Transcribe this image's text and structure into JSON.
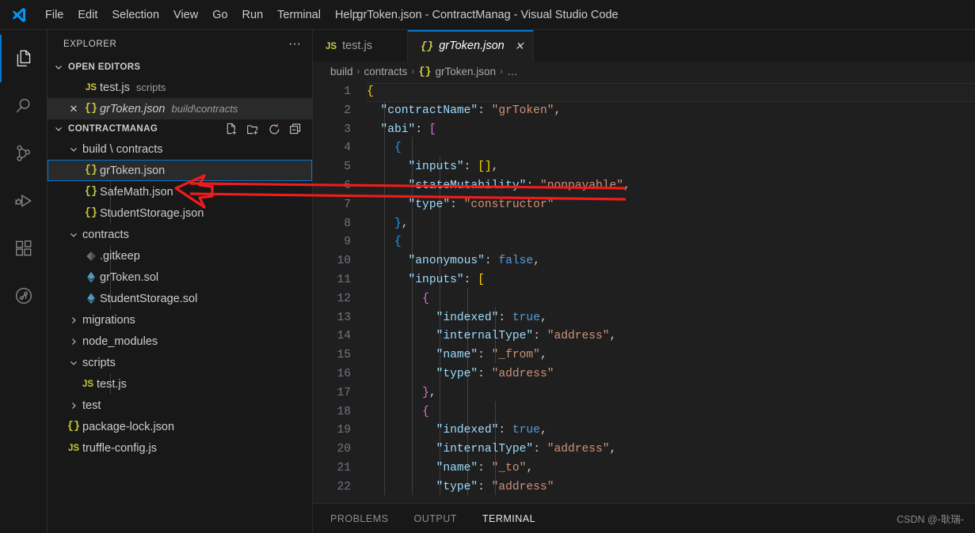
{
  "window": {
    "title": "grToken.json - ContractManag - Visual Studio Code",
    "logo_icon": "vscode-logo-icon"
  },
  "menubar": {
    "items": [
      {
        "label": "File"
      },
      {
        "label": "Edit"
      },
      {
        "label": "Selection"
      },
      {
        "label": "View"
      },
      {
        "label": "Go"
      },
      {
        "label": "Run"
      },
      {
        "label": "Terminal"
      },
      {
        "label": "Help"
      }
    ]
  },
  "activitybar": {
    "items": [
      {
        "icon": "explorer-files-icon",
        "name": "explorer",
        "active": true
      },
      {
        "icon": "search-icon",
        "name": "search",
        "active": false
      },
      {
        "icon": "source-control-icon",
        "name": "source-control",
        "active": false
      },
      {
        "icon": "run-debug-icon",
        "name": "run-and-debug",
        "active": false
      },
      {
        "icon": "extensions-icon",
        "name": "extensions",
        "active": false
      },
      {
        "icon": "testing-beaker-icon",
        "name": "testing",
        "active": false
      }
    ]
  },
  "sidebar": {
    "header_title": "EXPLORER",
    "header_more_icon": "ellipsis-icon",
    "open_editors": {
      "label": "OPEN EDITORS",
      "expanded": true,
      "chevron_icon": "chevron-down-icon",
      "items": [
        {
          "name": "test.js",
          "description": "scripts",
          "icon": "js-file-icon",
          "dirty": false,
          "active": false,
          "closable": false
        },
        {
          "name": "grToken.json",
          "description": "build\\contracts",
          "icon": "json-file-icon",
          "dirty": false,
          "active": true,
          "closable": true,
          "close_icon": "close-icon"
        }
      ]
    },
    "workspace": {
      "label": "CONTRACTMANAG",
      "chevron_icon": "chevron-down-icon",
      "actions": [
        {
          "icon": "new-file-icon",
          "name": "new-file"
        },
        {
          "icon": "new-folder-icon",
          "name": "new-folder"
        },
        {
          "icon": "refresh-icon",
          "name": "refresh-explorer"
        },
        {
          "icon": "collapse-all-icon",
          "name": "collapse-folders"
        }
      ],
      "tree": [
        {
          "label": "build \\ contracts",
          "type": "folder",
          "expanded": true,
          "depth": 1,
          "icon": "chevron-down-icon"
        },
        {
          "label": "grToken.json",
          "type": "file",
          "depth": 2,
          "icon": "json-file-icon",
          "selected": true
        },
        {
          "label": "SafeMath.json",
          "type": "file",
          "depth": 2,
          "icon": "json-file-icon",
          "selected": false
        },
        {
          "label": "StudentStorage.json",
          "type": "file",
          "depth": 2,
          "icon": "json-file-icon",
          "selected": false
        },
        {
          "label": "contracts",
          "type": "folder",
          "expanded": true,
          "depth": 1,
          "icon": "chevron-down-icon"
        },
        {
          "label": ".gitkeep",
          "type": "file",
          "depth": 2,
          "icon": "git-file-icon",
          "selected": false
        },
        {
          "label": "grToken.sol",
          "type": "file",
          "depth": 2,
          "icon": "solidity-file-icon",
          "selected": false
        },
        {
          "label": "StudentStorage.sol",
          "type": "file",
          "depth": 2,
          "icon": "solidity-file-icon",
          "selected": false
        },
        {
          "label": "migrations",
          "type": "folder",
          "expanded": false,
          "depth": 1,
          "icon": "chevron-right-icon"
        },
        {
          "label": "node_modules",
          "type": "folder",
          "expanded": false,
          "depth": 1,
          "icon": "chevron-right-icon"
        },
        {
          "label": "scripts",
          "type": "folder",
          "expanded": true,
          "depth": 1,
          "icon": "chevron-down-icon"
        },
        {
          "label": "test.js",
          "type": "file",
          "depth": 2,
          "icon": "js-file-icon",
          "selected": false
        },
        {
          "label": "test",
          "type": "folder",
          "expanded": false,
          "depth": 1,
          "icon": "chevron-right-icon"
        },
        {
          "label": "package-lock.json",
          "type": "file",
          "depth": 1,
          "icon": "json-file-icon",
          "selected": false
        },
        {
          "label": "truffle-config.js",
          "type": "file",
          "depth": 1,
          "icon": "js-file-icon",
          "selected": false
        }
      ]
    }
  },
  "editor": {
    "tabs": [
      {
        "label": "test.js",
        "icon": "js-file-icon",
        "active": false,
        "closable": false
      },
      {
        "label": "grToken.json",
        "icon": "json-file-icon",
        "active": true,
        "closable": true,
        "close_icon": "close-icon"
      }
    ],
    "breadcrumb": [
      {
        "label": "build",
        "icon": null
      },
      {
        "label": "contracts",
        "icon": null
      },
      {
        "label": "grToken.json",
        "icon": "json-file-icon"
      },
      {
        "label": "…",
        "icon": null
      }
    ],
    "breadcrumb_separator": "›",
    "first_line_number": 1,
    "lines": [
      {
        "n": 1,
        "indent": 0,
        "tokens": [
          {
            "t": "{",
            "c": "k-brace1"
          }
        ],
        "current": true
      },
      {
        "n": 2,
        "indent": 1,
        "tokens": [
          {
            "t": "\"contractName\"",
            "c": "k-key"
          },
          {
            "t": ": ",
            "c": "k-punc"
          },
          {
            "t": "\"grToken\"",
            "c": "k-str"
          },
          {
            "t": ",",
            "c": "k-punc"
          }
        ]
      },
      {
        "n": 3,
        "indent": 1,
        "tokens": [
          {
            "t": "\"abi\"",
            "c": "k-key"
          },
          {
            "t": ": ",
            "c": "k-punc"
          },
          {
            "t": "[",
            "c": "k-brace2"
          }
        ]
      },
      {
        "n": 4,
        "indent": 2,
        "tokens": [
          {
            "t": "{",
            "c": "k-brace3"
          }
        ]
      },
      {
        "n": 5,
        "indent": 3,
        "tokens": [
          {
            "t": "\"inputs\"",
            "c": "k-key"
          },
          {
            "t": ": ",
            "c": "k-punc"
          },
          {
            "t": "[]",
            "c": "k-brace1"
          },
          {
            "t": ",",
            "c": "k-punc"
          }
        ]
      },
      {
        "n": 6,
        "indent": 3,
        "tokens": [
          {
            "t": "\"stateMutability\"",
            "c": "k-key"
          },
          {
            "t": ": ",
            "c": "k-punc"
          },
          {
            "t": "\"nonpayable\"",
            "c": "k-str"
          },
          {
            "t": ",",
            "c": "k-punc"
          }
        ]
      },
      {
        "n": 7,
        "indent": 3,
        "tokens": [
          {
            "t": "\"type\"",
            "c": "k-key"
          },
          {
            "t": ": ",
            "c": "k-punc"
          },
          {
            "t": "\"constructor\"",
            "c": "k-str"
          }
        ]
      },
      {
        "n": 8,
        "indent": 2,
        "tokens": [
          {
            "t": "}",
            "c": "k-brace3"
          },
          {
            "t": ",",
            "c": "k-punc"
          }
        ]
      },
      {
        "n": 9,
        "indent": 2,
        "tokens": [
          {
            "t": "{",
            "c": "k-brace3"
          }
        ]
      },
      {
        "n": 10,
        "indent": 3,
        "tokens": [
          {
            "t": "\"anonymous\"",
            "c": "k-key"
          },
          {
            "t": ": ",
            "c": "k-punc"
          },
          {
            "t": "false",
            "c": "k-bool"
          },
          {
            "t": ",",
            "c": "k-punc"
          }
        ]
      },
      {
        "n": 11,
        "indent": 3,
        "tokens": [
          {
            "t": "\"inputs\"",
            "c": "k-key"
          },
          {
            "t": ": ",
            "c": "k-punc"
          },
          {
            "t": "[",
            "c": "k-brace1"
          }
        ]
      },
      {
        "n": 12,
        "indent": 4,
        "tokens": [
          {
            "t": "{",
            "c": "k-brace2"
          }
        ]
      },
      {
        "n": 13,
        "indent": 5,
        "tokens": [
          {
            "t": "\"indexed\"",
            "c": "k-key"
          },
          {
            "t": ": ",
            "c": "k-punc"
          },
          {
            "t": "true",
            "c": "k-bool"
          },
          {
            "t": ",",
            "c": "k-punc"
          }
        ]
      },
      {
        "n": 14,
        "indent": 5,
        "tokens": [
          {
            "t": "\"internalType\"",
            "c": "k-key"
          },
          {
            "t": ": ",
            "c": "k-punc"
          },
          {
            "t": "\"address\"",
            "c": "k-str"
          },
          {
            "t": ",",
            "c": "k-punc"
          }
        ]
      },
      {
        "n": 15,
        "indent": 5,
        "tokens": [
          {
            "t": "\"name\"",
            "c": "k-key"
          },
          {
            "t": ": ",
            "c": "k-punc"
          },
          {
            "t": "\"_from\"",
            "c": "k-str"
          },
          {
            "t": ",",
            "c": "k-punc"
          }
        ]
      },
      {
        "n": 16,
        "indent": 5,
        "tokens": [
          {
            "t": "\"type\"",
            "c": "k-key"
          },
          {
            "t": ": ",
            "c": "k-punc"
          },
          {
            "t": "\"address\"",
            "c": "k-str"
          }
        ]
      },
      {
        "n": 17,
        "indent": 4,
        "tokens": [
          {
            "t": "}",
            "c": "k-brace2"
          },
          {
            "t": ",",
            "c": "k-punc"
          }
        ]
      },
      {
        "n": 18,
        "indent": 4,
        "tokens": [
          {
            "t": "{",
            "c": "k-brace2"
          }
        ]
      },
      {
        "n": 19,
        "indent": 5,
        "tokens": [
          {
            "t": "\"indexed\"",
            "c": "k-key"
          },
          {
            "t": ": ",
            "c": "k-punc"
          },
          {
            "t": "true",
            "c": "k-bool"
          },
          {
            "t": ",",
            "c": "k-punc"
          }
        ]
      },
      {
        "n": 20,
        "indent": 5,
        "tokens": [
          {
            "t": "\"internalType\"",
            "c": "k-key"
          },
          {
            "t": ": ",
            "c": "k-punc"
          },
          {
            "t": "\"address\"",
            "c": "k-str"
          },
          {
            "t": ",",
            "c": "k-punc"
          }
        ]
      },
      {
        "n": 21,
        "indent": 5,
        "tokens": [
          {
            "t": "\"name\"",
            "c": "k-key"
          },
          {
            "t": ": ",
            "c": "k-punc"
          },
          {
            "t": "\"_to\"",
            "c": "k-str"
          },
          {
            "t": ",",
            "c": "k-punc"
          }
        ]
      },
      {
        "n": 22,
        "indent": 5,
        "tokens": [
          {
            "t": "\"type\"",
            "c": "k-key"
          },
          {
            "t": ": ",
            "c": "k-punc"
          },
          {
            "t": "\"address\"",
            "c": "k-str"
          }
        ]
      }
    ]
  },
  "panel": {
    "tabs": [
      {
        "label": "PROBLEMS",
        "active": false
      },
      {
        "label": "OUTPUT",
        "active": false
      },
      {
        "label": "TERMINAL",
        "active": true
      }
    ],
    "watermark": "CSDN @-耿瑞-"
  },
  "annotation": {
    "arrow_color": "#ef1c1c",
    "description": "red arrow pointing to grToken.json in the explorer"
  },
  "colors": {
    "accent": "#0078d4",
    "titlebar_bg": "#181818",
    "sidebar_bg": "#181818",
    "editor_bg": "#1f1f1f",
    "selected_row_bg": "#2a2a2a",
    "text": "#cccccc"
  }
}
